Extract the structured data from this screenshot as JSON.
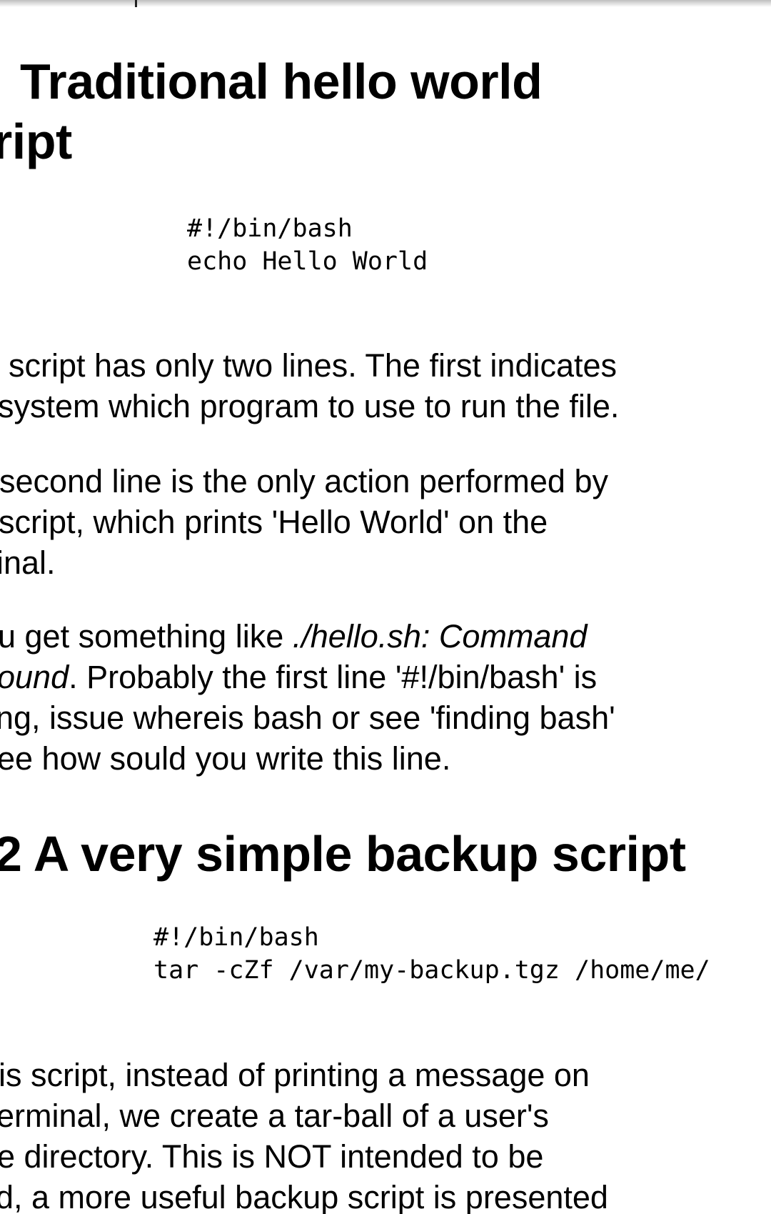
{
  "sections": {
    "hello": {
      "heading_line1": "Traditional hello world",
      "heading_line2": "ript",
      "code_lines": [
        "#!/bin/bash",
        "echo Hello World"
      ],
      "para1": {
        "l1": "script has only two lines. The first indicates",
        "l2": "system which program to use to run the file."
      },
      "para2": {
        "l1": "second line is the only action performed by",
        "l2": "script, which prints 'Hello World' on the",
        "l3": "inal."
      },
      "para3": {
        "l1_a": "u get something like ",
        "l1_em": "./hello.sh: Command",
        "l2_em": "ound",
        "l2_b": ". Probably the first line '#!/bin/bash' is",
        "l3": "ng, issue whereis bash or see 'finding bash'",
        "l4": "ee how sould you write this line."
      }
    },
    "backup": {
      "heading": "2 A very simple backup script",
      "code_lines": [
        "#!/bin/bash",
        "tar -cZf /var/my-backup.tgz /home/me/"
      ],
      "para1": {
        "l1": "is script, instead of printing a message on",
        "l2": "erminal, we create a tar-ball of a user's",
        "l3": "e directory. This is NOT intended to be",
        "l4": "d, a more useful backup script is presented"
      }
    }
  }
}
